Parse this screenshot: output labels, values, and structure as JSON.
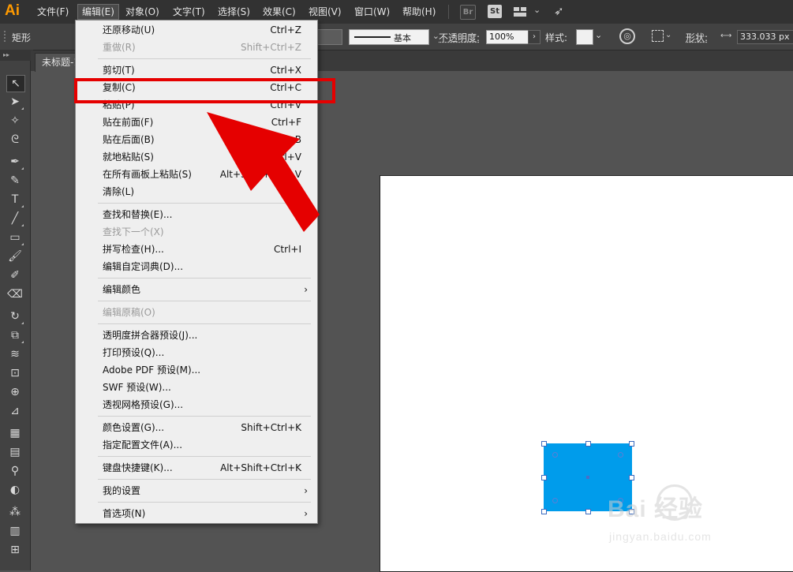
{
  "app": {
    "logo": "Ai"
  },
  "menubar": {
    "items": [
      "文件(F)",
      "编辑(E)",
      "对象(O)",
      "文字(T)",
      "选择(S)",
      "效果(C)",
      "视图(V)",
      "窗口(W)",
      "帮助(H)"
    ],
    "active": "编辑(E)",
    "bridge": "Br",
    "stock": "St"
  },
  "control_bar": {
    "object_type": "矩形",
    "stroke_profile": "基本",
    "opacity_label": "不透明度",
    "opacity_value": "100%",
    "style_label": "样式",
    "shape_label": "形状",
    "width_value": "333.033 px"
  },
  "document": {
    "tab_title": "未标题-1"
  },
  "edit_menu": {
    "items": [
      {
        "label": "还原移动(U)",
        "shortcut": "Ctrl+Z",
        "enabled": true
      },
      {
        "label": "重做(R)",
        "shortcut": "Shift+Ctrl+Z",
        "enabled": false
      },
      {
        "label": "剪切(T)",
        "shortcut": "Ctrl+X",
        "enabled": true
      },
      {
        "label": "复制(C)",
        "shortcut": "Ctrl+C",
        "enabled": true
      },
      {
        "label": "粘贴(P)",
        "shortcut": "Ctrl+V",
        "enabled": true
      },
      {
        "label": "贴在前面(F)",
        "shortcut": "Ctrl+F",
        "enabled": true
      },
      {
        "label": "贴在后面(B)",
        "shortcut": "Ctrl+B",
        "enabled": true
      },
      {
        "label": "就地粘贴(S)",
        "shortcut": "Shift+Ctrl+V",
        "enabled": true
      },
      {
        "label": "在所有画板上粘贴(S)",
        "shortcut": "Alt+Shift+Ctrl+V",
        "enabled": true
      },
      {
        "label": "清除(L)",
        "shortcut": "",
        "enabled": true
      },
      {
        "label": "查找和替换(E)...",
        "shortcut": "",
        "enabled": true
      },
      {
        "label": "查找下一个(X)",
        "shortcut": "",
        "enabled": false
      },
      {
        "label": "拼写检查(H)...",
        "shortcut": "Ctrl+I",
        "enabled": true
      },
      {
        "label": "编辑自定词典(D)...",
        "shortcut": "",
        "enabled": true
      },
      {
        "label": "编辑颜色",
        "shortcut": "",
        "enabled": true,
        "submenu": true
      },
      {
        "label": "编辑原稿(O)",
        "shortcut": "",
        "enabled": false
      },
      {
        "label": "透明度拼合器预设(J)...",
        "shortcut": "",
        "enabled": true
      },
      {
        "label": "打印预设(Q)...",
        "shortcut": "",
        "enabled": true
      },
      {
        "label": "Adobe PDF 预设(M)...",
        "shortcut": "",
        "enabled": true
      },
      {
        "label": "SWF 预设(W)...",
        "shortcut": "",
        "enabled": true
      },
      {
        "label": "透视网格预设(G)...",
        "shortcut": "",
        "enabled": true
      },
      {
        "label": "颜色设置(G)...",
        "shortcut": "Shift+Ctrl+K",
        "enabled": true
      },
      {
        "label": "指定配置文件(A)...",
        "shortcut": "",
        "enabled": true
      },
      {
        "label": "键盘快捷键(K)...",
        "shortcut": "Alt+Shift+Ctrl+K",
        "enabled": true
      },
      {
        "label": "我的设置",
        "shortcut": "",
        "enabled": true,
        "submenu": true
      },
      {
        "label": "首选项(N)",
        "shortcut": "",
        "enabled": true,
        "submenu": true
      }
    ],
    "highlighted": "复制(C)"
  },
  "colors": {
    "accent": "#e50000",
    "shape_fill": "#009ceb",
    "logo": "#ff9a00"
  },
  "watermark": {
    "brand": "Bai 经验",
    "url": "jingyan.baidu.com"
  }
}
